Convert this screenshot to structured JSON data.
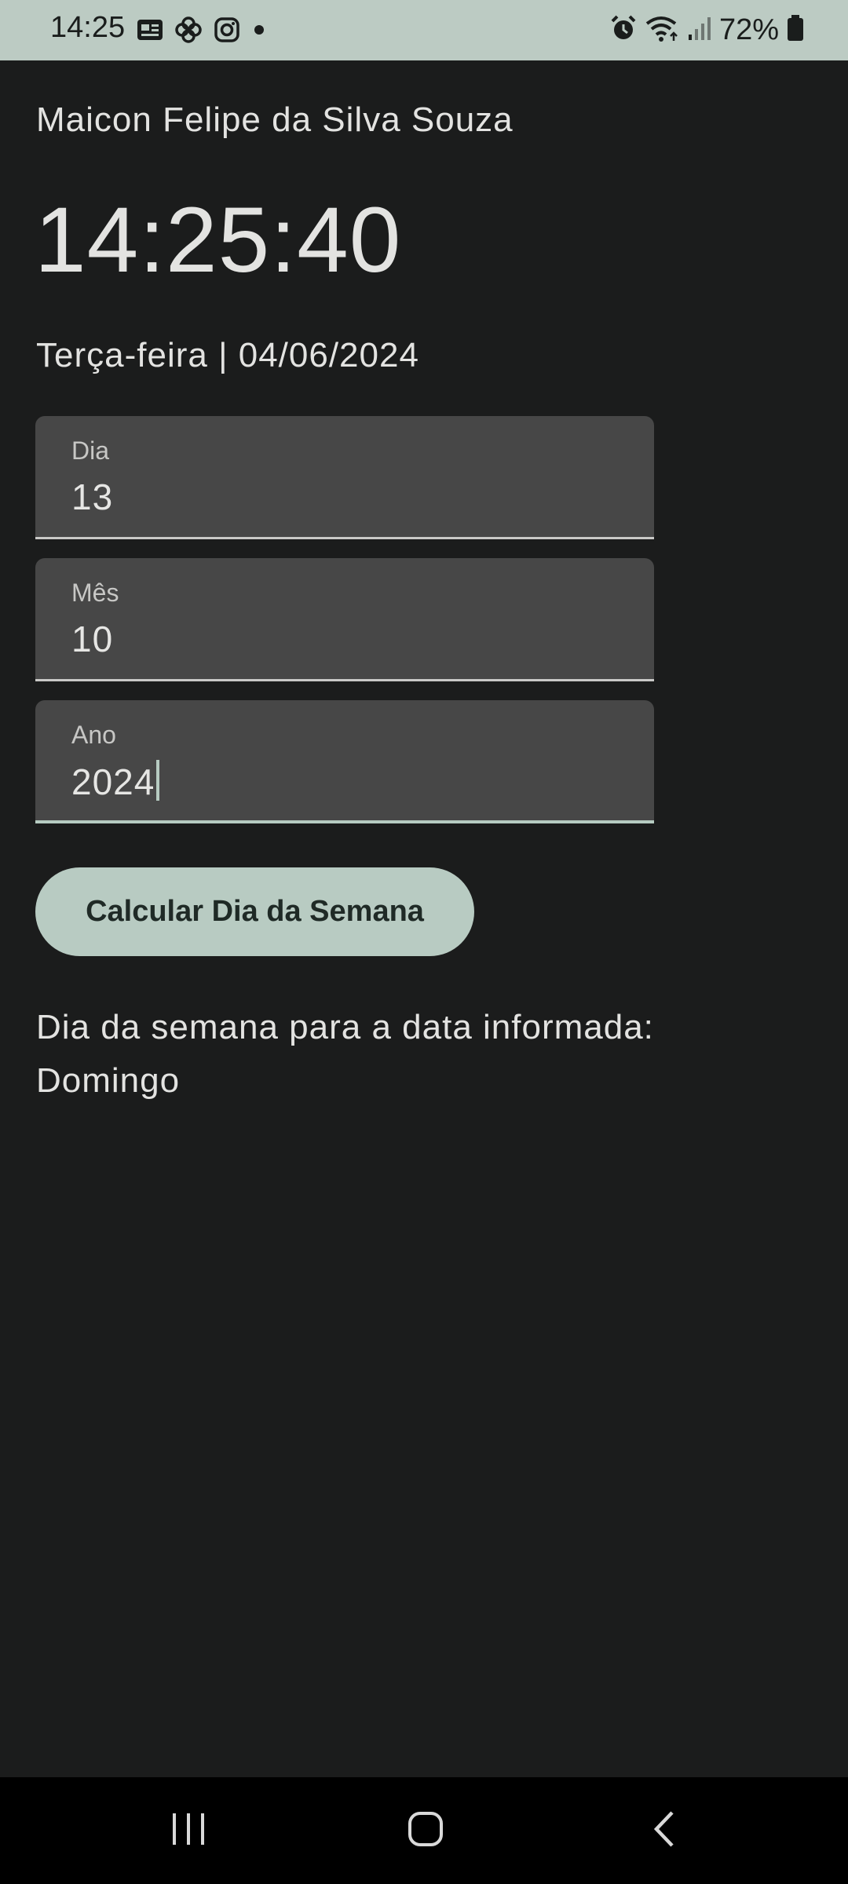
{
  "status_bar": {
    "time": "14:25",
    "notification_icons": [
      "news-icon",
      "pinwheel-icon",
      "instagram-icon",
      "more-dot-icon"
    ],
    "system_icons": [
      "alarm-icon",
      "wifi-icon",
      "signal-icon",
      "battery-icon"
    ],
    "battery_percent": "72%"
  },
  "header": {
    "owner_name": "Maicon Felipe da Silva Souza",
    "clock": "14:25:40",
    "current_date": "Terça-feira | 04/06/2024"
  },
  "form": {
    "fields": [
      {
        "label": "Dia",
        "value": "13"
      },
      {
        "label": "Mês",
        "value": "10"
      },
      {
        "label": "Ano",
        "value": "2024"
      }
    ],
    "calculate_label": "Calcular Dia da Semana"
  },
  "result": {
    "prefix": "Dia da semana para a data informada:",
    "weekday": "Domingo"
  },
  "colors": {
    "background": "#1b1c1c",
    "status_bar": "#bccbc3",
    "field_background": "#474747",
    "accent": "#b8cbc2",
    "text": "#e3e3e1"
  },
  "nav_bar": {
    "icons": [
      "recent-apps-icon",
      "home-icon",
      "back-icon"
    ]
  }
}
